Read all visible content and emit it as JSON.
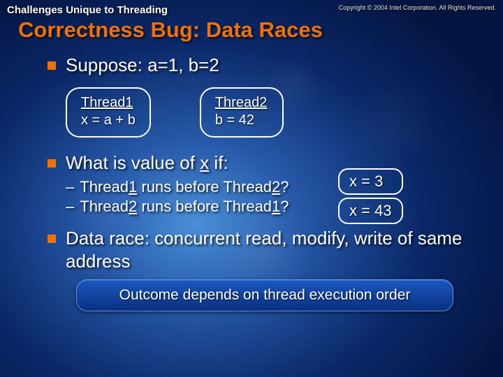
{
  "header": {
    "section": "Challenges Unique to Threading",
    "copyright": "Copyright © 2004 Intel Corporation. All Rights Reserved."
  },
  "title": "Correctness Bug: Data Races",
  "bullets": {
    "suppose": "Suppose: a=1, b=2",
    "whatis_pre": "What is value of ",
    "whatis_var": "x",
    "whatis_post": " if:",
    "datarace": "Data race: concurrent read, modify, write of same address"
  },
  "threads": {
    "t1_name": "Thread1",
    "t1_expr": "x = a + b",
    "t2_name": "Thread2",
    "t2_expr": "b = 42"
  },
  "scenarios": {
    "s1_pre": "Thread",
    "s1_a": "1",
    "s1_mid": " runs before Thread",
    "s1_b": "2",
    "s1_q": "?",
    "s1_ans": "x = 3",
    "s2_pre": "Thread",
    "s2_a": "2",
    "s2_mid": " runs before Thread",
    "s2_b": "1",
    "s2_q": "?",
    "s2_ans": "x = 43"
  },
  "outcome": "Outcome depends on thread execution order"
}
